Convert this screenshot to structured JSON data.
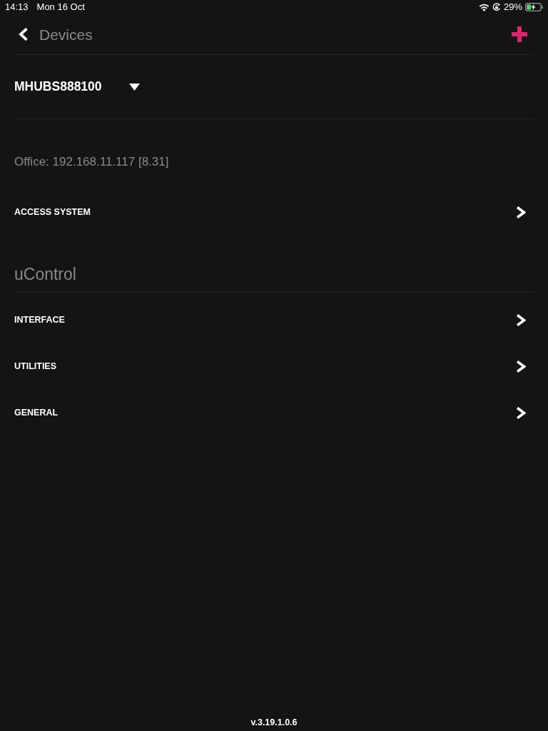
{
  "status_bar": {
    "time": "14:13",
    "date": "Mon 16 Oct",
    "battery": "29%"
  },
  "nav": {
    "back_label": "Devices"
  },
  "device_selector": {
    "value": "MHUBS888100"
  },
  "connection": "Office: 192.168.11.117 [8.31]",
  "top_items": [
    {
      "label": "ACCESS SYSTEM"
    }
  ],
  "section": {
    "title": "uControl",
    "items": [
      {
        "label": "INTERFACE"
      },
      {
        "label": "UTILITIES"
      },
      {
        "label": "GENERAL"
      }
    ]
  },
  "footer": {
    "version": "v.3.19.1.0.6"
  }
}
